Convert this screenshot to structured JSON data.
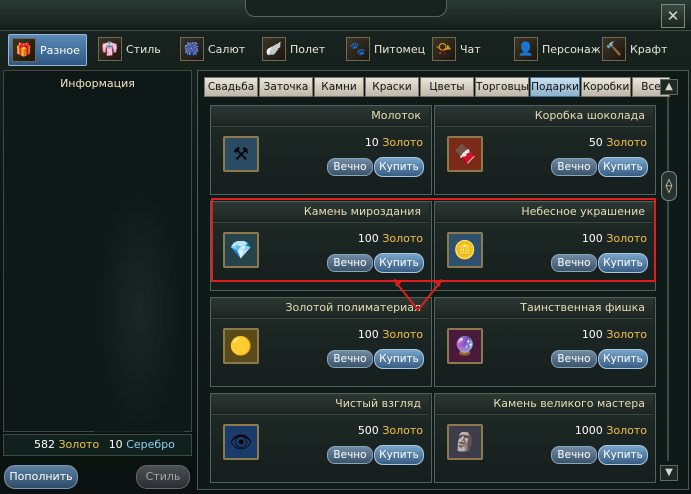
{
  "window": {
    "close_label": "✕"
  },
  "categories": [
    {
      "label": "Разное",
      "icon": "gift-icon",
      "glyph": "🎁",
      "active": true
    },
    {
      "label": "Стиль",
      "icon": "costume-icon",
      "glyph": "👘"
    },
    {
      "label": "Салют",
      "icon": "fireworks-icon",
      "glyph": "🎆"
    },
    {
      "label": "Полет",
      "icon": "wings-icon",
      "glyph": "🪽"
    },
    {
      "label": "Питомец",
      "icon": "pet-icon",
      "glyph": "🐾"
    },
    {
      "label": "Чат",
      "icon": "horn-icon",
      "glyph": "📯"
    },
    {
      "label": "Персонаж",
      "icon": "character-icon",
      "glyph": "👤"
    },
    {
      "label": "Крафт",
      "icon": "hammer-icon",
      "glyph": "🔨"
    }
  ],
  "left_panel": {
    "title": "Информация"
  },
  "money": {
    "gold_amount": "582",
    "gold_label": "Золото",
    "silver_amount": "10",
    "silver_label": "Серебро"
  },
  "buttons": {
    "topup": "Пополнить",
    "style": "Стиль"
  },
  "tabs": [
    "Свадьба",
    "Заточка",
    "Камни",
    "Краски",
    "Цветы",
    "Торговцы",
    "Подарки",
    "Коробки",
    "Все"
  ],
  "active_tab": "Подарки",
  "items": [
    {
      "name": "Молоток",
      "price": "10",
      "currency": "Золото",
      "icon": "hammer-icon",
      "glyph": "⚒",
      "bg": "#2b4b62"
    },
    {
      "name": "Коробка шоколада",
      "price": "50",
      "currency": "Золото",
      "icon": "chocolate-box-icon",
      "glyph": "🍫",
      "bg": "#7b2a1a"
    },
    {
      "name": "Камень мироздания",
      "price": "100",
      "currency": "Золото",
      "icon": "crystal-stone-icon",
      "glyph": "💎",
      "bg": "#26434a"
    },
    {
      "name": "Небесное украшение",
      "price": "100",
      "currency": "Золото",
      "icon": "sky-ornament-icon",
      "glyph": "🪙",
      "bg": "#2e4f6e"
    },
    {
      "name": "Золотой полиматериал",
      "price": "100",
      "currency": "Золото",
      "icon": "gold-material-icon",
      "glyph": "🟡",
      "bg": "#5a4a1a"
    },
    {
      "name": "Таинственная фишка",
      "price": "100",
      "currency": "Золото",
      "icon": "mystery-chip-icon",
      "glyph": "🔮",
      "bg": "#4a1a3a"
    },
    {
      "name": "Чистый взгляд",
      "price": "500",
      "currency": "Золото",
      "icon": "eye-icon",
      "glyph": "👁",
      "bg": "#1a3c6a"
    },
    {
      "name": "Камень великого мастера",
      "price": "1000",
      "currency": "Золото",
      "icon": "master-stone-icon",
      "glyph": "🗿",
      "bg": "#3c3c4a"
    }
  ],
  "item_buttons": {
    "forever": "Вечно",
    "buy": "Купить"
  },
  "highlight_color": "#e21d1d"
}
